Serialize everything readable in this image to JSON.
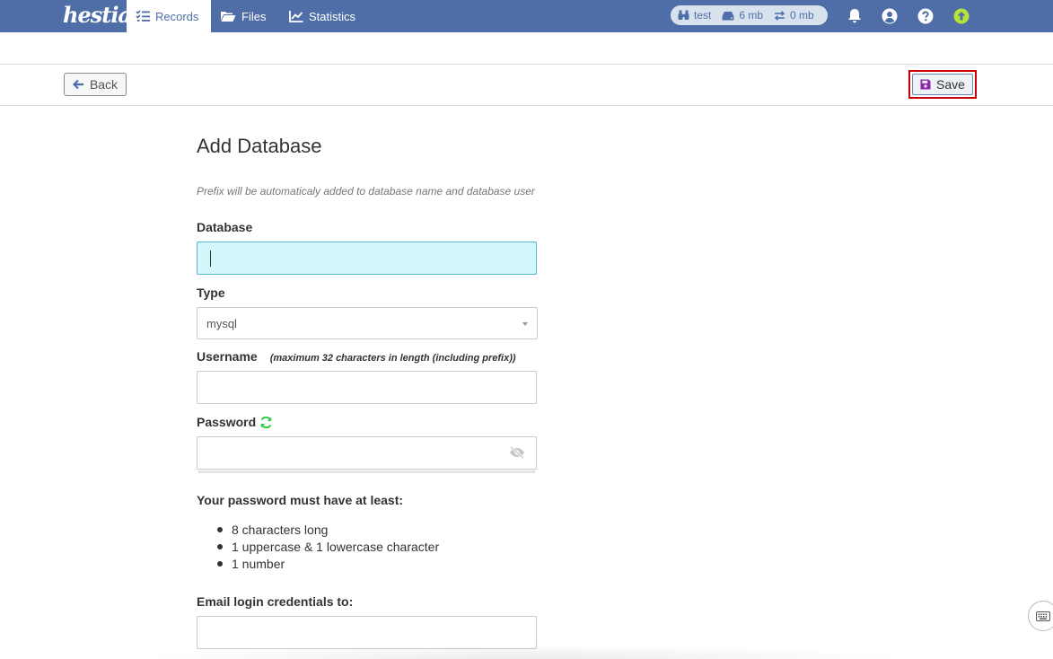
{
  "app": {
    "logo_text": "hestia"
  },
  "nav": {
    "records": "Records",
    "files": "Files",
    "statistics": "Statistics"
  },
  "usage": {
    "user": "test",
    "disk": "6 mb",
    "bandwidth": "0 mb"
  },
  "actions": {
    "back": "Back",
    "save": "Save"
  },
  "form": {
    "title": "Add Database",
    "hint": "Prefix will be automaticaly added to database name and database user",
    "database_label": "Database",
    "database_value": "",
    "type_label": "Type",
    "type_value": "mysql",
    "username_label": "Username",
    "username_note": "(maximum 32 characters in length (including prefix))",
    "username_value": "",
    "password_label": "Password",
    "password_value": "",
    "requirements_title": "Your password must have at least:",
    "requirements": [
      "8 characters long",
      "1 uppercase & 1 lowercase character",
      "1 number"
    ],
    "email_label": "Email login credentials to:",
    "email_value": ""
  },
  "colors": {
    "topbar": "#4f6ea7",
    "focus_field": "#d3f7fb",
    "save_icon": "#8e24aa",
    "refresh_icon": "#2ecc40",
    "update_icon": "#b6e03a"
  },
  "icons": {
    "records": "list-check-icon",
    "files": "folder-open-icon",
    "statistics": "chart-line-icon",
    "user": "binoculars-icon",
    "disk": "hdd-icon",
    "bandwidth": "arrows-exchange-icon",
    "notifications": "bell-icon",
    "profile": "user-circle-icon",
    "help": "question-circle-icon",
    "update": "arrow-up-circle-icon",
    "back": "arrow-left-icon",
    "save": "floppy-disk-icon",
    "generate_password": "refresh-icon",
    "toggle_password": "eye-slash-icon",
    "keyboard": "keyboard-icon"
  }
}
